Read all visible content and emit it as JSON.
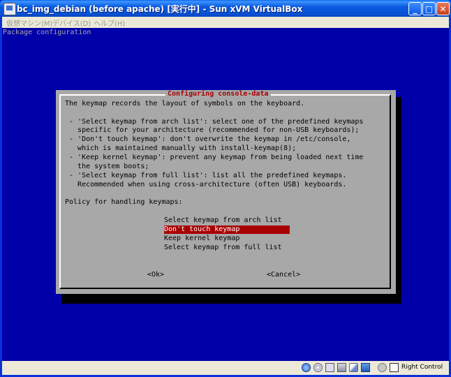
{
  "window": {
    "title": "bc_img_debian (before apache) [実行中] - Sun xVM VirtualBox",
    "controls": {
      "minimize": "_",
      "maximize": "□",
      "close": "✕"
    }
  },
  "menu": [
    "仮想マシン(M)",
    "デバイス(D)",
    "ヘルプ(H)"
  ],
  "screen": {
    "header": "Package configuration",
    "dialog": {
      "title": "Configuring console-data",
      "lines": [
        "The keymap records the layout of symbols on the keyboard.",
        "",
        " - 'Select keymap from arch list': select one of the predefined keymaps",
        "   specific for your architecture (recommended for non-USB keyboards);",
        " - 'Don't touch keymap': don't overwrite the keymap in /etc/console,",
        "   which is maintained manually with install-keymap(8);",
        " - 'Keep kernel keymap': prevent any keymap from being loaded next time",
        "   the system boots;",
        " - 'Select keymap from full list': list all the predefined keymaps.",
        "   Recommended when using cross-architecture (often USB) keyboards.",
        "",
        "Policy for handling keymaps:"
      ],
      "options": [
        {
          "label": "Select keymap from arch list",
          "selected": false
        },
        {
          "label": "Don't touch keymap",
          "selected": true
        },
        {
          "label": "Keep kernel keymap",
          "selected": false
        },
        {
          "label": "Select keymap from full list",
          "selected": false
        }
      ],
      "ok_label": "<Ok>",
      "cancel_label": "<Cancel>"
    }
  },
  "statusbar": {
    "icons": [
      "hard-disk-icon",
      "cd-rom-icon",
      "floppy-icon",
      "network-icon",
      "usb-icon",
      "shared-folders-icon",
      "mouse-integration-icon",
      "host-key-icon"
    ],
    "host_key": "Right Control"
  },
  "colors": {
    "screen_bg": "#0000a8",
    "dialog_bg": "#a8a8a8",
    "accent_red": "#a80000",
    "title_bar": "#0a5ae0"
  }
}
